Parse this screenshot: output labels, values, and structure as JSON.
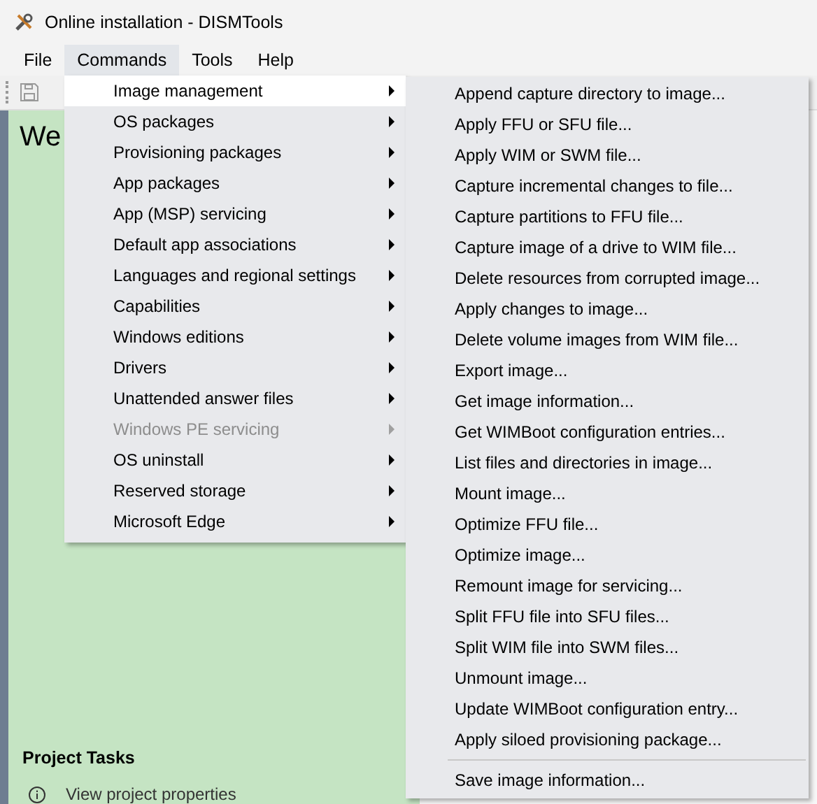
{
  "window": {
    "title": "Online installation - DISMTools"
  },
  "menubar": [
    {
      "label": "File",
      "selected": false
    },
    {
      "label": "Commands",
      "selected": true
    },
    {
      "label": "Tools",
      "selected": false
    },
    {
      "label": "Help",
      "selected": false
    }
  ],
  "main": {
    "heading": "We",
    "tasks_title": "Project Tasks",
    "tasks": [
      "View project properties"
    ]
  },
  "menu": [
    {
      "label": "Image management",
      "selected": true,
      "disabled": false
    },
    {
      "label": "OS packages",
      "selected": false,
      "disabled": false
    },
    {
      "label": "Provisioning packages",
      "selected": false,
      "disabled": false
    },
    {
      "label": "App packages",
      "selected": false,
      "disabled": false
    },
    {
      "label": "App (MSP) servicing",
      "selected": false,
      "disabled": false
    },
    {
      "label": "Default app associations",
      "selected": false,
      "disabled": false
    },
    {
      "label": "Languages and regional settings",
      "selected": false,
      "disabled": false
    },
    {
      "label": "Capabilities",
      "selected": false,
      "disabled": false
    },
    {
      "label": "Windows editions",
      "selected": false,
      "disabled": false
    },
    {
      "label": "Drivers",
      "selected": false,
      "disabled": false
    },
    {
      "label": "Unattended answer files",
      "selected": false,
      "disabled": false
    },
    {
      "label": "Windows PE servicing",
      "selected": false,
      "disabled": true
    },
    {
      "label": "OS uninstall",
      "selected": false,
      "disabled": false
    },
    {
      "label": "Reserved storage",
      "selected": false,
      "disabled": false
    },
    {
      "label": "Microsoft Edge",
      "selected": false,
      "disabled": false
    }
  ],
  "submenu": [
    {
      "kind": "item",
      "label": "Append capture directory to image..."
    },
    {
      "kind": "item",
      "label": "Apply FFU or SFU file..."
    },
    {
      "kind": "item",
      "label": "Apply WIM or SWM file..."
    },
    {
      "kind": "item",
      "label": "Capture incremental changes to file..."
    },
    {
      "kind": "item",
      "label": "Capture partitions to FFU file..."
    },
    {
      "kind": "item",
      "label": "Capture image of a drive to WIM file..."
    },
    {
      "kind": "item",
      "label": "Delete resources from corrupted image..."
    },
    {
      "kind": "item",
      "label": "Apply changes to image..."
    },
    {
      "kind": "item",
      "label": "Delete volume images from WIM file..."
    },
    {
      "kind": "item",
      "label": "Export image..."
    },
    {
      "kind": "item",
      "label": "Get image information..."
    },
    {
      "kind": "item",
      "label": "Get WIMBoot configuration entries..."
    },
    {
      "kind": "item",
      "label": "List files and directories in image..."
    },
    {
      "kind": "item",
      "label": "Mount image..."
    },
    {
      "kind": "item",
      "label": "Optimize FFU file..."
    },
    {
      "kind": "item",
      "label": "Optimize image..."
    },
    {
      "kind": "item",
      "label": "Remount image for servicing..."
    },
    {
      "kind": "item",
      "label": "Split FFU file into SFU files..."
    },
    {
      "kind": "item",
      "label": "Split WIM file into SWM files..."
    },
    {
      "kind": "item",
      "label": "Unmount image..."
    },
    {
      "kind": "item",
      "label": "Update WIMBoot configuration entry..."
    },
    {
      "kind": "item",
      "label": "Apply siloed provisioning package..."
    },
    {
      "kind": "separator"
    },
    {
      "kind": "item",
      "label": "Save image information..."
    }
  ]
}
